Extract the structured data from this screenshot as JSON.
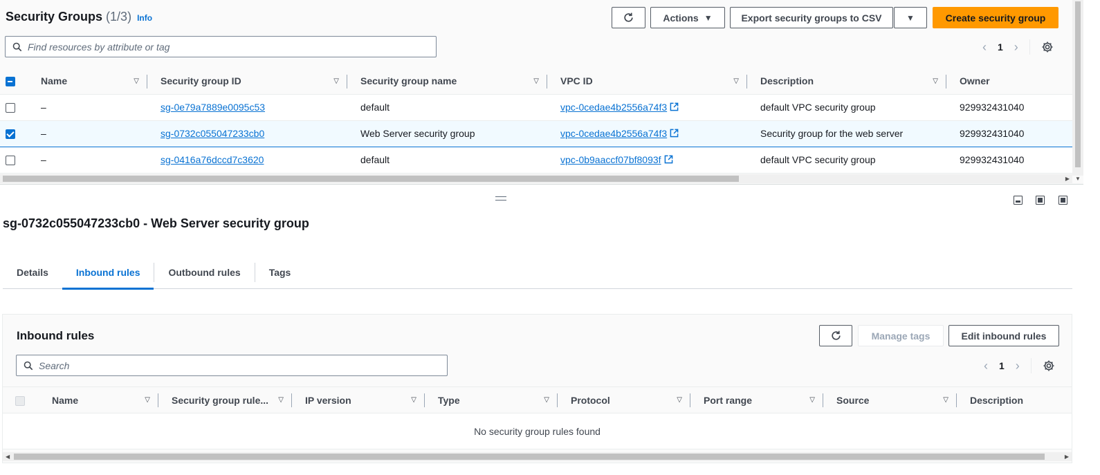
{
  "header": {
    "title": "Security Groups",
    "count": "(1/3)",
    "info": "Info",
    "actions_label": "Actions",
    "export_label": "Export security groups to CSV",
    "create_label": "Create security group",
    "search_placeholder": "Find resources by attribute or tag",
    "page": "1"
  },
  "table": {
    "columns": [
      "Name",
      "Security group ID",
      "Security group name",
      "VPC ID",
      "Description",
      "Owner"
    ],
    "rows": [
      {
        "selected": false,
        "name": "–",
        "sg_id": "sg-0e79a7889e0095c53",
        "sg_name": "default",
        "vpc_id": "vpc-0cedae4b2556a74f3",
        "description": "default VPC security group",
        "owner": "929932431040"
      },
      {
        "selected": true,
        "name": "–",
        "sg_id": "sg-0732c055047233cb0",
        "sg_name": "Web Server security group",
        "vpc_id": "vpc-0cedae4b2556a74f3",
        "description": "Security group for the web server",
        "owner": "929932431040"
      },
      {
        "selected": false,
        "name": "–",
        "sg_id": "sg-0416a76dccd7c3620",
        "sg_name": "default",
        "vpc_id": "vpc-0b9aaccf07bf8093f",
        "description": "default VPC security group",
        "owner": "929932431040"
      }
    ]
  },
  "detail": {
    "title": "sg-0732c055047233cb0 - Web Server security group",
    "tabs": [
      "Details",
      "Inbound rules",
      "Outbound rules",
      "Tags"
    ],
    "active_tab": 1
  },
  "inbound": {
    "title": "Inbound rules",
    "manage_tags_label": "Manage tags",
    "edit_label": "Edit inbound rules",
    "search_placeholder": "Search",
    "page": "1",
    "columns": [
      "Name",
      "Security group rule...",
      "IP version",
      "Type",
      "Protocol",
      "Port range",
      "Source",
      "Description"
    ],
    "empty_text": "No security group rules found"
  },
  "colors": {
    "primary": "#ff9900",
    "link": "#0972d3",
    "selected_row": "#f1faff"
  },
  "icons": [
    "refresh-icon",
    "search-icon",
    "gear-icon",
    "external-link-icon",
    "caret-down-icon",
    "sort-icon",
    "panel-layout-icon"
  ]
}
